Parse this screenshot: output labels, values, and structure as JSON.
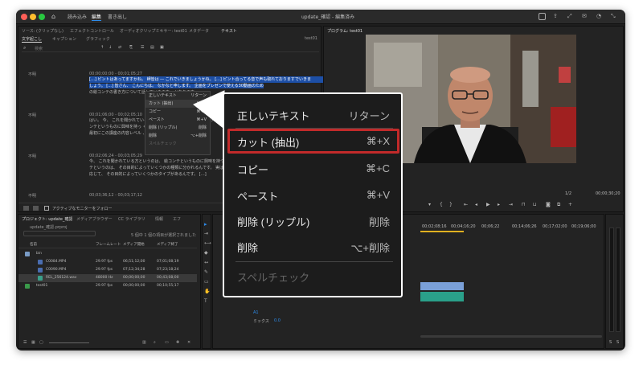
{
  "titlebar": {
    "title": "update_確認 - 編集済み",
    "tabs": [
      "読み込み",
      "編集",
      "書き出し"
    ],
    "active_tab": "編集"
  },
  "panel_tabs": [
    "ソース: (クリップなし)",
    "エフェクトコントロール",
    "オーディオクリップミキサー: test01",
    "メタデータ",
    "テキスト"
  ],
  "text_panel": {
    "subtabs": [
      "文字起こし",
      "キャプション",
      "グラフィック"
    ],
    "sequence": "test01",
    "search_placeholder": "検索",
    "speaker": "不明",
    "paragraphs": [
      {
        "speaker": "不明",
        "time": "00;00;00;00 - 00;01;05;27",
        "line1": "[…] ピントはあってますかね。 岬皆は ― これでいきましょうかね。 [...] ピント合ってる音で声も取れておりますでいきま",
        "line2": "しょう。 [...] 皆さん、 こんにちは。 なかなと申します。 企画をプレゼンで使える30動画のため",
        "line3": "の絵コンテの書き方について話していきます。 とあります。"
      },
      {
        "speaker": "不明",
        "time": "00;01;06;00 - 00;02;05;10",
        "line1": "はい。 今、 これを聞かれている方というのは、 絵コンテなどに向けたいとい",
        "line2": "ンテというものに興味を持っ くいう方が多いと思うんですけど、",
        "line3": "最初にこの講座の内容レベル 、 お話ししたいと思います。"
      },
      {
        "speaker": "不明",
        "time": "00;02;06;24 - 00;03;05;29",
        "line1": "今、 これを聞かれている方というのは、 絵コンテというものに興味を持つ",
        "line2": "テというのは、 その目的によっていくつかの種類に分かれるんです。 実は",
        "line3": "応じて、 その目的によっていくつかのタイプがあるんです。 […]"
      },
      {
        "speaker": "不明",
        "time": "00;03;36;12 - 00;03;17;12",
        "line1": "",
        "line2": "",
        "line3": ""
      }
    ],
    "footer_label": "アクティブなモニターをフォロー"
  },
  "small_context_menu": {
    "items": [
      {
        "label": "正しいテキスト",
        "shortcut": "リターン"
      },
      {
        "label": "カット (抽出)",
        "shortcut": "⌘+X"
      },
      {
        "label": "コピー",
        "shortcut": "⌘+C"
      },
      {
        "label": "ペースト",
        "shortcut": "⌘+V"
      },
      {
        "label": "削除 (リップル)",
        "shortcut": "削除"
      },
      {
        "label": "削除",
        "shortcut": "⌥+削除"
      },
      {
        "label": "スペルチェック",
        "shortcut": ""
      }
    ]
  },
  "context_menu": {
    "items": [
      {
        "label": "正しいテキスト",
        "shortcut": "リターン"
      },
      {
        "label": "カット (抽出)",
        "shortcut": "⌘+X"
      },
      {
        "label": "コピー",
        "shortcut": "⌘+C"
      },
      {
        "label": "ペースト",
        "shortcut": "⌘+V"
      },
      {
        "label": "削除 (リップル)",
        "shortcut": "削除"
      },
      {
        "label": "削除",
        "shortcut": "⌥+削除"
      },
      {
        "label": "スペルチェック",
        "shortcut": ""
      }
    ],
    "highlighted_index": 1
  },
  "program_monitor": {
    "title": "プログラム: test01",
    "timecode": "00;00;30;20",
    "zoom": "1/2"
  },
  "project_panel": {
    "tabs": [
      "プロジェクト: update_確認",
      "メディアブラウザー",
      "CC ライブラリ",
      "情報",
      "エフ"
    ],
    "project_file": "update_確認.prproj",
    "selection_info": "5 個中 1 個の項目が選択されました",
    "columns": [
      "名前",
      "フレームレート",
      "メディア開始",
      "メディア終了"
    ],
    "files": [
      {
        "name": "bin",
        "fps": "",
        "start": "",
        "end": "",
        "color": "#7a9cc6"
      },
      {
        "name": "C0084.MP4",
        "fps": "29.97 fps",
        "start": "06;51;12;00",
        "end": "07;01;08;19",
        "color": "#4a6db0"
      },
      {
        "name": "C0090.MP4",
        "fps": "29.97 fps",
        "start": "07;12;34;28",
        "end": "07;23;18;24",
        "color": "#4a6db0"
      },
      {
        "name": "REL_256124.wav",
        "fps": "48000 Hz",
        "start": "00;00;00;00",
        "end": "00;43;08;00",
        "color": "#3aa08a"
      },
      {
        "name": "test01",
        "fps": "29.97 fps",
        "start": "00;00;00;00",
        "end": "00;10;55;17",
        "color": "#3a9a4a"
      }
    ]
  },
  "timeline": {
    "ticks": [
      "00;02;08;16",
      "00;04;16;20",
      "00;06;22",
      "00;14;06;26",
      "00;17;02;00",
      "00;19;06;00"
    ],
    "tracks": [
      "A1",
      "ミックス"
    ],
    "mix_value": "0.0"
  },
  "audio_meter": {
    "labels": [
      "S",
      "S"
    ]
  }
}
